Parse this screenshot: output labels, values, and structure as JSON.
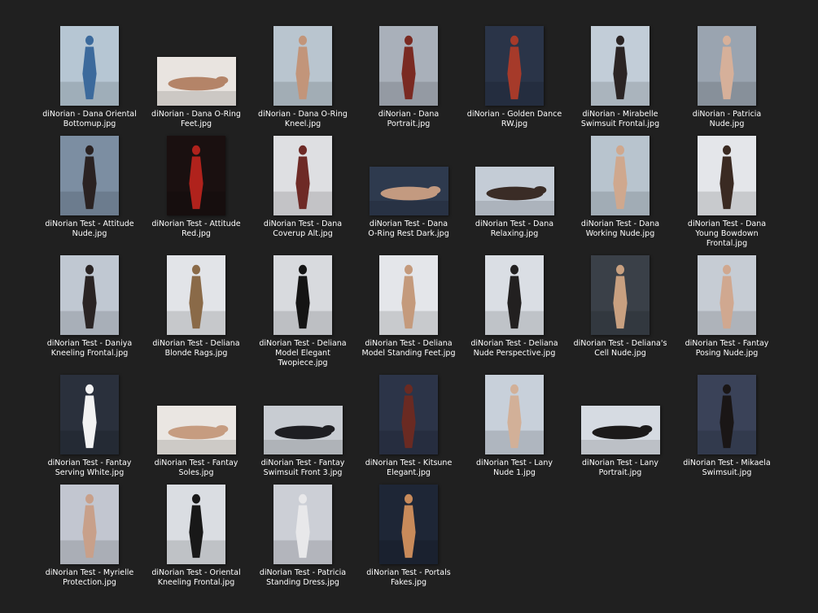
{
  "view": {
    "name": "large-icons-file-grid",
    "background": "#202020",
    "label_color": "#ffffff"
  },
  "files": [
    {
      "name": "diNorian - Dana Oriental\nBottomup.jpg",
      "shape": "portrait",
      "palette": [
        "#b6c6d3",
        "#3c6a9c"
      ]
    },
    {
      "name": "diNorian - Dana O-Ring\nFeet.jpg",
      "shape": "landscape",
      "palette": [
        "#e9e4e0",
        "#b48468"
      ]
    },
    {
      "name": "diNorian - Dana O-Ring\nKneel.jpg",
      "shape": "portrait",
      "palette": [
        "#b9c5cf",
        "#c2957a"
      ]
    },
    {
      "name": "diNorian - Dana\nPortrait.jpg",
      "shape": "portrait",
      "palette": [
        "#a9b0ba",
        "#7a2a22"
      ]
    },
    {
      "name": "diNorian - Golden Dance\nRW.jpg",
      "shape": "portrait",
      "palette": [
        "#2a3448",
        "#a63a2a"
      ]
    },
    {
      "name": "diNorian - Mirabelle\nSwimsuit Frontal.jpg",
      "shape": "portrait",
      "palette": [
        "#c2cdd8",
        "#2b2424"
      ]
    },
    {
      "name": "diNorian - Patricia\nNude.jpg",
      "shape": "portrait",
      "palette": [
        "#9aa4b0",
        "#d6b09a"
      ]
    },
    {
      "name": "diNorian Test - Attitude\nNude.jpg",
      "shape": "portrait",
      "palette": [
        "#7c8ea2",
        "#2a2222"
      ]
    },
    {
      "name": "diNorian Test - Attitude\nRed.jpg",
      "shape": "portrait",
      "palette": [
        "#1a1010",
        "#b0221c"
      ]
    },
    {
      "name": "diNorian Test - Dana\nCoverup Alt.jpg",
      "shape": "portrait",
      "palette": [
        "#dedfe2",
        "#6e2a26"
      ]
    },
    {
      "name": "diNorian Test - Dana\nO-Ring Rest Dark.jpg",
      "shape": "landscape",
      "palette": [
        "#2e3a4e",
        "#c39a80"
      ]
    },
    {
      "name": "diNorian Test - Dana\nRelaxing.jpg",
      "shape": "landscape",
      "palette": [
        "#c4ccd6",
        "#3a2c26"
      ]
    },
    {
      "name": "diNorian Test - Dana\nWorking Nude.jpg",
      "shape": "portrait",
      "palette": [
        "#b8c4ce",
        "#cfa88e"
      ]
    },
    {
      "name": "diNorian Test - Dana\nYoung Bowdown\nFrontal.jpg",
      "shape": "portrait",
      "palette": [
        "#e4e6ea",
        "#3a2a22"
      ]
    },
    {
      "name": "diNorian Test - Daniya\nKneeling Frontal.jpg",
      "shape": "portrait",
      "palette": [
        "#c0c8d2",
        "#2a2424"
      ]
    },
    {
      "name": "diNorian Test - Deliana\nBlonde Rags.jpg",
      "shape": "portrait",
      "palette": [
        "#e2e4e8",
        "#8a6a48"
      ]
    },
    {
      "name": "diNorian Test - Deliana\nModel Elegant\nTwopiece.jpg",
      "shape": "portrait",
      "palette": [
        "#d8dade",
        "#141414"
      ]
    },
    {
      "name": "diNorian Test - Deliana\nModel Standing Feet.jpg",
      "shape": "portrait",
      "palette": [
        "#e4e6ea",
        "#c49a7c"
      ]
    },
    {
      "name": "diNorian Test - Deliana\nNude Perspective.jpg",
      "shape": "portrait",
      "palette": [
        "#dadee4",
        "#222020"
      ]
    },
    {
      "name": "diNorian Test - Deliana's\nCell Nude.jpg",
      "shape": "portrait",
      "palette": [
        "#3a4048",
        "#c8a080"
      ]
    },
    {
      "name": "diNorian Test - Fantay\nPosing Nude.jpg",
      "shape": "portrait",
      "palette": [
        "#c6ccd4",
        "#d0a890"
      ]
    },
    {
      "name": "diNorian Test - Fantay\nServing White.jpg",
      "shape": "portrait",
      "palette": [
        "#2a303c",
        "#f2f2f2"
      ]
    },
    {
      "name": "diNorian Test - Fantay\nSoles.jpg",
      "shape": "landscape",
      "palette": [
        "#eae6e2",
        "#c69c80"
      ]
    },
    {
      "name": "diNorian Test - Fantay\nSwimsuit Front 3.jpg",
      "shape": "landscape",
      "palette": [
        "#c8ccd2",
        "#1e1e22"
      ]
    },
    {
      "name": "diNorian Test - Kitsune\nElegant.jpg",
      "shape": "portrait",
      "palette": [
        "#2c3448",
        "#6a2a22"
      ]
    },
    {
      "name": "diNorian Test - Lany\nNude 1.jpg",
      "shape": "portrait",
      "palette": [
        "#c8d0da",
        "#d2b098"
      ]
    },
    {
      "name": "diNorian Test - Lany\nPortrait.jpg",
      "shape": "landscape",
      "palette": [
        "#d6dbe2",
        "#1c1a1a"
      ]
    },
    {
      "name": "diNorian Test - Mikaela\nSwimsuit.jpg",
      "shape": "portrait",
      "palette": [
        "#3a4258",
        "#1a1616"
      ]
    },
    {
      "name": "diNorian Test - Myrielle\nProtection.jpg",
      "shape": "portrait",
      "palette": [
        "#c2c6d0",
        "#c8a08a"
      ]
    },
    {
      "name": "diNorian Test - Oriental\nKneeling Frontal.jpg",
      "shape": "portrait",
      "palette": [
        "#dadde2",
        "#181818"
      ]
    },
    {
      "name": "diNorian Test - Patricia\nStanding Dress.jpg",
      "shape": "portrait",
      "palette": [
        "#cccfd6",
        "#e8e8ea"
      ]
    },
    {
      "name": "diNorian Test - Portals\nFakes.jpg",
      "shape": "portrait",
      "palette": [
        "#1e2636",
        "#c88a5a"
      ]
    }
  ]
}
